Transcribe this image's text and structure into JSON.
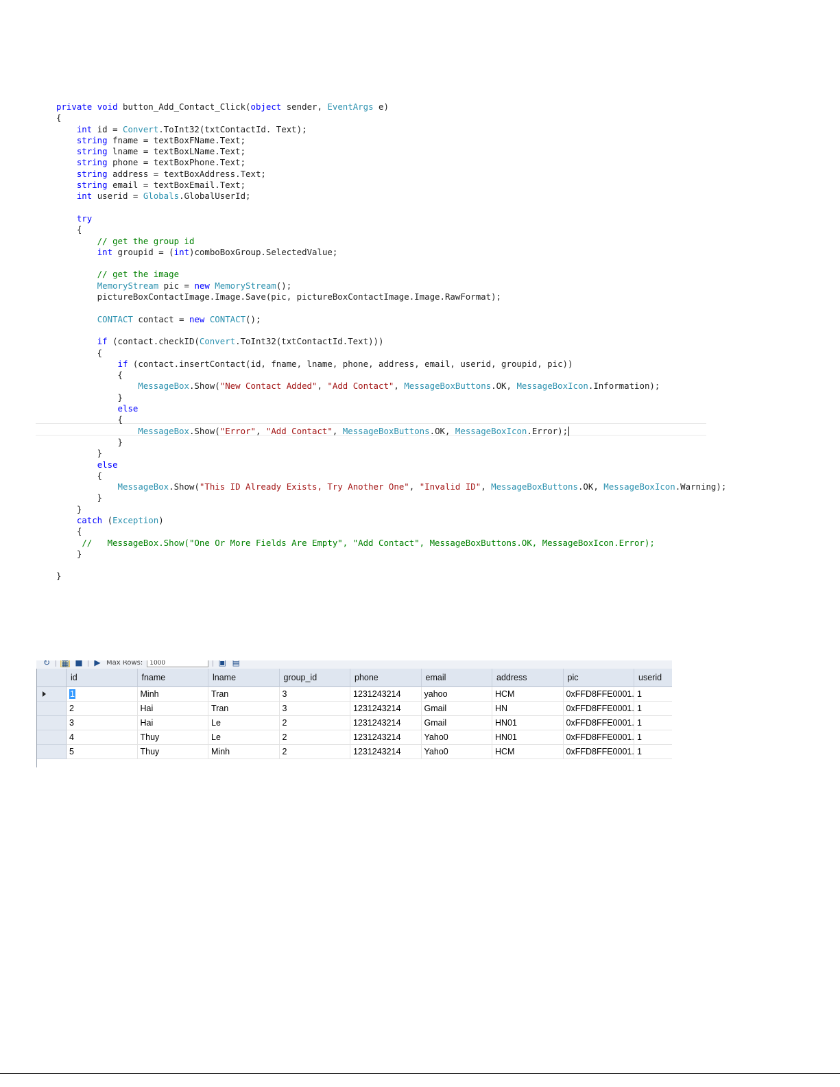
{
  "code_editor": {
    "lines": [
      [
        {
          "t": "private",
          "c": "kw"
        },
        {
          "t": " "
        },
        {
          "t": "void",
          "c": "kw"
        },
        {
          "t": " button_Add_Contact_Click("
        },
        {
          "t": "object",
          "c": "kw"
        },
        {
          "t": " sender, "
        },
        {
          "t": "EventArgs",
          "c": "type"
        },
        {
          "t": " e)"
        }
      ],
      [
        {
          "t": "{"
        }
      ],
      [
        {
          "t": "    "
        },
        {
          "t": "int",
          "c": "kw"
        },
        {
          "t": " id = "
        },
        {
          "t": "Convert",
          "c": "type"
        },
        {
          "t": ".ToInt32(txtContactId. Text);"
        }
      ],
      [
        {
          "t": "    "
        },
        {
          "t": "string",
          "c": "kw"
        },
        {
          "t": " fname = textBoxFName.Text;"
        }
      ],
      [
        {
          "t": "    "
        },
        {
          "t": "string",
          "c": "kw"
        },
        {
          "t": " lname = textBoxLName.Text;"
        }
      ],
      [
        {
          "t": "    "
        },
        {
          "t": "string",
          "c": "kw"
        },
        {
          "t": " phone = textBoxPhone.Text;"
        }
      ],
      [
        {
          "t": "    "
        },
        {
          "t": "string",
          "c": "kw"
        },
        {
          "t": " address = textBoxAddress.Text;"
        }
      ],
      [
        {
          "t": "    "
        },
        {
          "t": "string",
          "c": "kw"
        },
        {
          "t": " email = textBoxEmail.Text;"
        }
      ],
      [
        {
          "t": "    "
        },
        {
          "t": "int",
          "c": "kw"
        },
        {
          "t": " userid = "
        },
        {
          "t": "Globals",
          "c": "type"
        },
        {
          "t": ".GlobalUserId;"
        }
      ],
      [],
      [
        {
          "t": "    "
        },
        {
          "t": "try",
          "c": "kw"
        }
      ],
      [
        {
          "t": "    {"
        }
      ],
      [
        {
          "t": "        "
        },
        {
          "t": "// get the group id",
          "c": "cmt"
        }
      ],
      [
        {
          "t": "        "
        },
        {
          "t": "int",
          "c": "kw"
        },
        {
          "t": " groupid = ("
        },
        {
          "t": "int",
          "c": "kw"
        },
        {
          "t": ")comboBoxGroup.SelectedValue;"
        }
      ],
      [],
      [
        {
          "t": "        "
        },
        {
          "t": "// get the image",
          "c": "cmt"
        }
      ],
      [
        {
          "t": "        "
        },
        {
          "t": "MemoryStream",
          "c": "type"
        },
        {
          "t": " pic = "
        },
        {
          "t": "new",
          "c": "kw"
        },
        {
          "t": " "
        },
        {
          "t": "MemoryStream",
          "c": "type"
        },
        {
          "t": "();"
        }
      ],
      [
        {
          "t": "        pictureBoxContactImage.Image.Save(pic, pictureBoxContactImage.Image.RawFormat);"
        }
      ],
      [],
      [
        {
          "t": "        "
        },
        {
          "t": "CONTACT",
          "c": "type"
        },
        {
          "t": " contact = "
        },
        {
          "t": "new",
          "c": "kw"
        },
        {
          "t": " "
        },
        {
          "t": "CONTACT",
          "c": "type"
        },
        {
          "t": "();"
        }
      ],
      [],
      [
        {
          "t": "        "
        },
        {
          "t": "if",
          "c": "kw"
        },
        {
          "t": " (contact.checkID("
        },
        {
          "t": "Convert",
          "c": "type"
        },
        {
          "t": ".ToInt32(txtContactId.Text)))"
        }
      ],
      [
        {
          "t": "        {"
        }
      ],
      [
        {
          "t": "            "
        },
        {
          "t": "if",
          "c": "kw"
        },
        {
          "t": " (contact.insertContact(id, fname, lname, phone, address, email, userid, groupid, pic))"
        }
      ],
      [
        {
          "t": "            {"
        }
      ],
      [
        {
          "t": "                "
        },
        {
          "t": "MessageBox",
          "c": "type"
        },
        {
          "t": ".Show("
        },
        {
          "t": "\"New Contact Added\"",
          "c": "str"
        },
        {
          "t": ", "
        },
        {
          "t": "\"Add Contact\"",
          "c": "str"
        },
        {
          "t": ", "
        },
        {
          "t": "MessageBoxButtons",
          "c": "type"
        },
        {
          "t": ".OK, "
        },
        {
          "t": "MessageBoxIcon",
          "c": "type"
        },
        {
          "t": ".Information);"
        }
      ],
      [
        {
          "t": "            }"
        }
      ],
      [
        {
          "t": "            "
        },
        {
          "t": "else",
          "c": "kw"
        }
      ],
      [
        {
          "t": "            {"
        }
      ],
      [
        {
          "t": "                "
        },
        {
          "t": "MessageBox",
          "c": "type"
        },
        {
          "t": ".Show("
        },
        {
          "t": "\"Error\"",
          "c": "str"
        },
        {
          "t": ", "
        },
        {
          "t": "\"Add Contact\"",
          "c": "str"
        },
        {
          "t": ", "
        },
        {
          "t": "MessageBoxButtons",
          "c": "type"
        },
        {
          "t": ".OK, "
        },
        {
          "t": "MessageBoxIcon",
          "c": "type"
        },
        {
          "t": ".Error);"
        }
      ],
      [
        {
          "t": "            }"
        }
      ],
      [
        {
          "t": "        }"
        }
      ],
      [
        {
          "t": "        "
        },
        {
          "t": "else",
          "c": "kw"
        }
      ],
      [
        {
          "t": "        {"
        }
      ],
      [
        {
          "t": "            "
        },
        {
          "t": "MessageBox",
          "c": "type"
        },
        {
          "t": ".Show("
        },
        {
          "t": "\"This ID Already Exists, Try Another One\"",
          "c": "str"
        },
        {
          "t": ", "
        },
        {
          "t": "\"Invalid ID\"",
          "c": "str"
        },
        {
          "t": ", "
        },
        {
          "t": "MessageBoxButtons",
          "c": "type"
        },
        {
          "t": ".OK, "
        },
        {
          "t": "MessageBoxIcon",
          "c": "type"
        },
        {
          "t": ".Warning);"
        }
      ],
      [
        {
          "t": "        }"
        }
      ],
      [
        {
          "t": "    }"
        }
      ],
      [
        {
          "t": "    "
        },
        {
          "t": "catch",
          "c": "kw"
        },
        {
          "t": " ("
        },
        {
          "t": "Exception",
          "c": "type"
        },
        {
          "t": ")"
        }
      ],
      [
        {
          "t": "    {"
        }
      ],
      [
        {
          "t": "     "
        },
        {
          "t": "//   MessageBox.Show(\"One Or More Fields Are Empty\", \"Add Contact\", MessageBoxButtons.OK, MessageBoxIcon.Error);",
          "c": "cmt"
        }
      ],
      [
        {
          "t": "    }"
        }
      ],
      [],
      [
        {
          "t": "}"
        }
      ]
    ],
    "current_line": 29
  },
  "results_grid": {
    "toolbar": {
      "max_rows_label": "Max Rows:",
      "max_rows_value": "1000"
    },
    "columns": [
      "id",
      "fname",
      "lname",
      "group_id",
      "phone",
      "email",
      "address",
      "pic",
      "userid"
    ],
    "rows": [
      [
        "1",
        "Minh",
        "Tran",
        "3",
        "1231243214",
        "yahoo",
        "HCM",
        "0xFFD8FFE0001...",
        "1"
      ],
      [
        "2",
        "Hai",
        "Tran",
        "3",
        "1231243214",
        "Gmail",
        "HN",
        "0xFFD8FFE0001...",
        "1"
      ],
      [
        "3",
        "Hai",
        "Le",
        "2",
        "1231243214",
        "Gmail",
        "HN01",
        "0xFFD8FFE0001...",
        "1"
      ],
      [
        "4",
        "Thuy",
        "Le",
        "2",
        "1231243214",
        "Yaho0",
        "HN01",
        "0xFFD8FFE0001...",
        "1"
      ],
      [
        "5",
        "Thuy",
        "Minh",
        "2",
        "1231243214",
        "Yaho0",
        "HCM",
        "0xFFD8FFE0001...",
        "1"
      ]
    ],
    "current_row": 0
  }
}
